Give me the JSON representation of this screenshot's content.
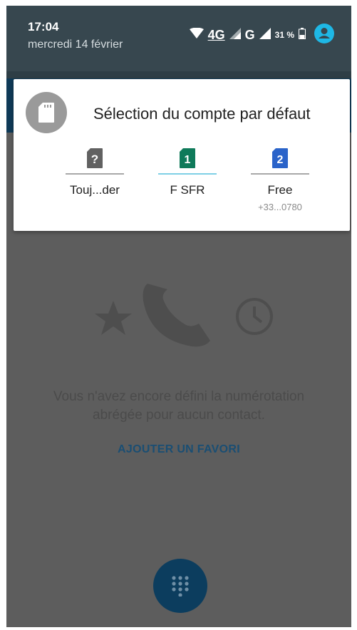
{
  "status_bar": {
    "time": "17:04",
    "date": "mercredi 14 février",
    "network_1": "4G",
    "network_2": "G",
    "battery_percent": "31 %",
    "icons": [
      "wifi-icon",
      "signal-icon",
      "battery-icon",
      "account-icon"
    ]
  },
  "dialog": {
    "title": "Sélection du compte par défaut",
    "header_icon": "sim-card-icon",
    "options": [
      {
        "icon": "question-sim-icon",
        "icon_text": "?",
        "label": "Touj...der",
        "sublabel": ""
      },
      {
        "icon": "sim-1-icon",
        "icon_text": "1",
        "label": "F SFR",
        "sublabel": "",
        "selected": true
      },
      {
        "icon": "sim-2-icon",
        "icon_text": "2",
        "label": "Free",
        "sublabel": "+33...0780"
      }
    ]
  },
  "empty_state": {
    "line1": "Vous n'avez encore défini la numérotation",
    "line2": "abrégée pour aucun contact.",
    "action_label": "AJOUTER UN FAVORI",
    "icons": [
      "star-icon",
      "phone-icon",
      "clock-icon"
    ]
  },
  "fab": {
    "icon": "dialpad-icon"
  },
  "colors": {
    "status_shade": "#37474f",
    "app_bar": "#0f3a57",
    "dim_overlay": "#5d5d5d",
    "sim1_green": "#0f7a5a",
    "sim2_blue": "#2a63c9",
    "accent_link": "#1a4e73",
    "selected_underline": "#7fd0e6"
  }
}
